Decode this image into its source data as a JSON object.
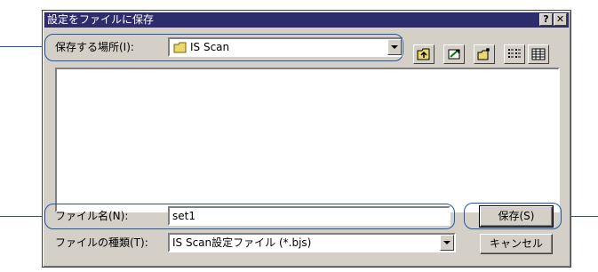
{
  "dialog": {
    "title": "設定をファイルに保存",
    "help_label": "?",
    "close_label": "✕"
  },
  "save_in": {
    "label": "保存する場所(I):",
    "value": "IS Scan"
  },
  "toolbar": {
    "icons": [
      "up-folder-icon",
      "desktop-icon",
      "new-folder-icon",
      "list-view-icon",
      "details-view-icon"
    ]
  },
  "file_name": {
    "label": "ファイル名(N):",
    "value": "set1"
  },
  "file_type": {
    "label": "ファイルの種類(T):",
    "value": "IS Scan設定ファイル (*.bjs)"
  },
  "buttons": {
    "save": "保存(S)",
    "cancel": "キャンセル"
  },
  "colors": {
    "titlebar": "#2d2d6e",
    "dialog_face": "#d4d0c8",
    "callout": "#1e58a8"
  }
}
